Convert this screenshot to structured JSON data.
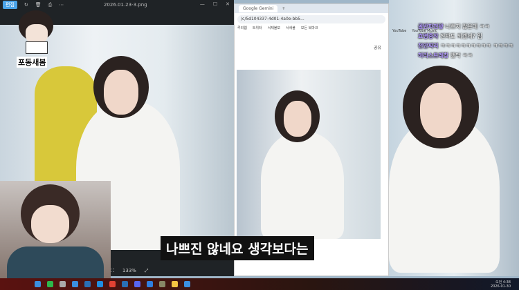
{
  "viewer": {
    "edit_label": "편집",
    "filename": "2026.01.23-3.png",
    "zoom": "133%",
    "window_controls": [
      "—",
      "☐",
      "✕"
    ]
  },
  "logo": {
    "text": "포동새봄"
  },
  "chrome": {
    "tab_title": "Google Gemini",
    "new_tab": "+",
    "url": "/c/5d104337-4d01-4a0e-bb5...",
    "bookmarks": [
      "루리웹",
      "트위터",
      "서제볼보",
      "서새볼",
      "모든 북마크"
    ],
    "share_label": "공유"
  },
  "right_bookmarks": [
    "YouTube",
    "YouTube Music"
  ],
  "chat": [
    {
      "nick": "골반파천왕",
      "msg": "나쁘지 않은데 ㅋㅋ"
    },
    {
      "nick": "효명중작",
      "msg": "진짜도 되겠네? 임"
    },
    {
      "nick": "천안찌리",
      "msg": "ㅋㅋㅋㅋㅋㅋㅋㅋㅋㅋ ㅋㅋㅋㅋ"
    },
    {
      "nick": "허리스트레칭",
      "msg": "했닥 ㅋㅋ"
    }
  ],
  "subtitle": "나쁘진 않네요 생각보다는",
  "taskbar": {
    "time": "오전 4:38",
    "date": "2026-01-30",
    "icon_colors": [
      "#3b8fe0",
      "#2db84b",
      "#aaa",
      "#3b8fe0",
      "#2a6fb5",
      "#1f8de0",
      "#e34133",
      "#2a6fb5",
      "#5865f2",
      "#2f7ee0",
      "#886",
      "#f5c542",
      "#3b8fe0"
    ]
  }
}
